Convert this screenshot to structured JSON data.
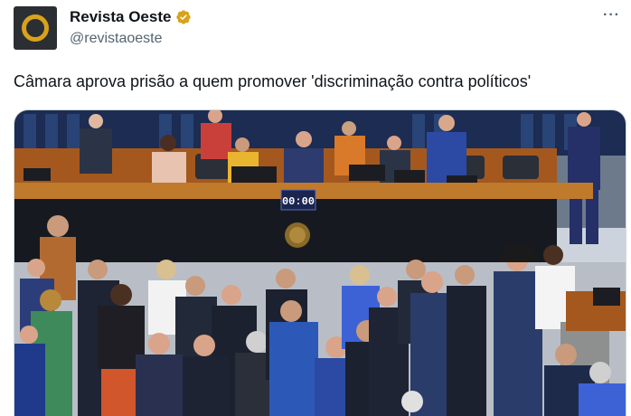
{
  "author": {
    "display_name": "Revista Oeste",
    "handle": "@revistaoeste",
    "verified_badge_icon": "verified-badge-icon",
    "avatar_icon": "ring-logo-icon",
    "verified_color": "#d9a21b"
  },
  "tweet": {
    "text": "Câmara aprova prisão a quem promover 'discriminação contra políticos'",
    "more_icon": "more-options-icon"
  },
  "media": {
    "panel_clock": "00:00"
  }
}
